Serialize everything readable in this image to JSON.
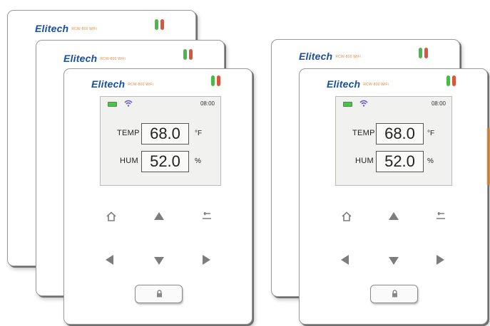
{
  "device": {
    "brand": "Elitech",
    "model": "RCW-800 WiFi",
    "clock": "08:00",
    "temp_label": "TEMP",
    "temp_value": "68.0",
    "temp_unit": "°F",
    "hum_label": "HUM",
    "hum_value": "52.0",
    "hum_unit": "%"
  },
  "icons": [
    "battery-icon",
    "wifi-icon",
    "home-icon",
    "up-arrow-icon",
    "back-icon",
    "left-arrow-icon",
    "down-arrow-icon",
    "right-arrow-icon",
    "lock-icon"
  ],
  "colors": {
    "brand": "#1b4fa0",
    "led_green": "#4cb84c",
    "led_red": "#d9553c",
    "screen": "#f1f2ef"
  }
}
